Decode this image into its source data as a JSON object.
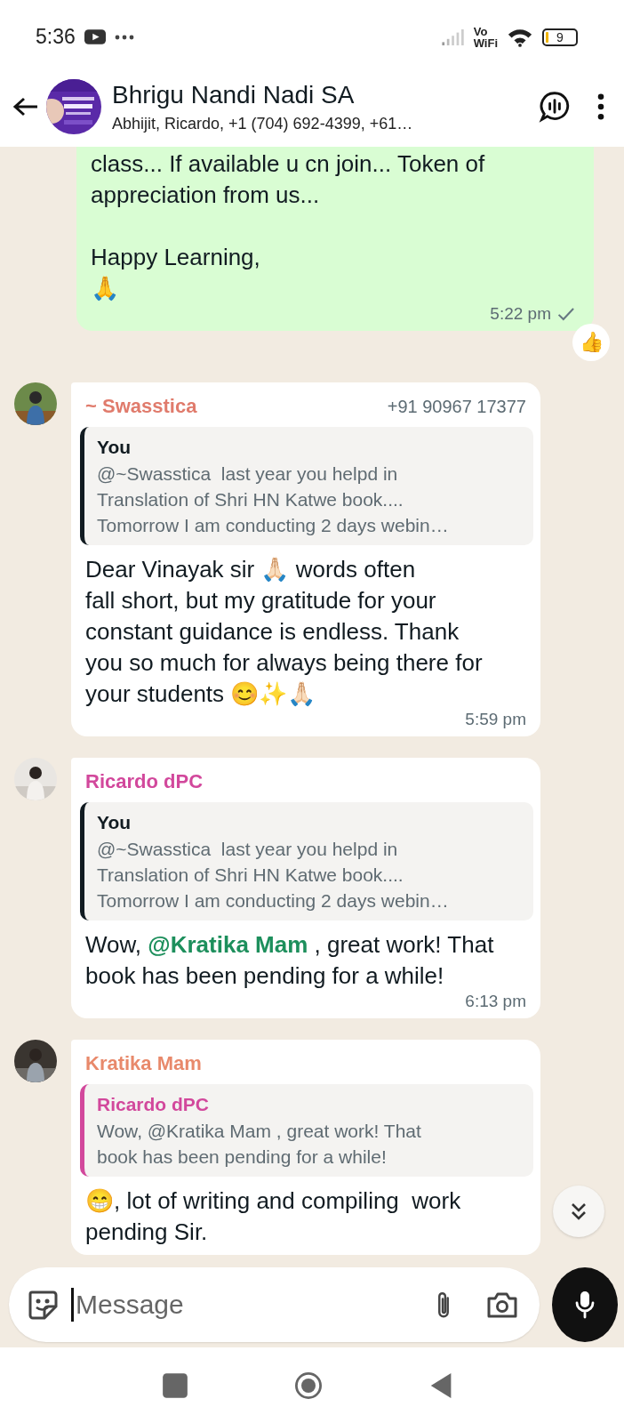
{
  "status_bar": {
    "time": "5:36",
    "network": [
      "Vo",
      "WiFi"
    ],
    "battery": "9"
  },
  "header": {
    "title": "Bhrigu Nandi Nadi SA",
    "subtitle": "Abhijit, Ricardo, +1 (704) 692-4399, +61…"
  },
  "messages": [
    {
      "kind": "outgoing",
      "text": "class... If available u cn join... Token of\nappreciation from us...\n\nHappy Learning,\n🙏",
      "time": "5:22 pm",
      "sent": true,
      "reaction": "👍"
    },
    {
      "kind": "incoming",
      "sender": "~ Swasstica",
      "color": "#e07b6c",
      "phone": "+91 90967 17377",
      "quote": {
        "author": "You",
        "color": "#111b21",
        "text": "@~Swasstica  last year you helpd in\nTranslation of Shri HN Katwe book....\nTomorrow I am conducting 2 days webin…"
      },
      "text": "Dear Vinayak sir 🙏🏻 words often\nfall short, but my gratitude for your\nconstant guidance is endless. Thank\nyou so much for always being there for\nyour students 😊✨🙏🏻",
      "time": "5:59 pm"
    },
    {
      "kind": "incoming",
      "sender": "Ricardo dPC",
      "color": "#d2489c",
      "quote": {
        "author": "You",
        "color": "#111b21",
        "text": "@~Swasstica  last year you helpd in\nTranslation of Shri HN Katwe book....\nTomorrow I am conducting 2 days webin…"
      },
      "text": "Wow, **@Kratika Mam** , great work! That\nbook has been pending for a while!",
      "time": "6:13 pm"
    },
    {
      "kind": "incoming",
      "sender": "Kratika Mam",
      "color": "#e8896b",
      "quote": {
        "author": "Ricardo dPC",
        "color": "#d2489c",
        "text": "Wow, @Kratika Mam , great work! That\nbook has been pending for a while!"
      },
      "text": "😁, lot of writing and compiling  work\npending Sir."
    }
  ],
  "composer": {
    "placeholder": "Message"
  }
}
